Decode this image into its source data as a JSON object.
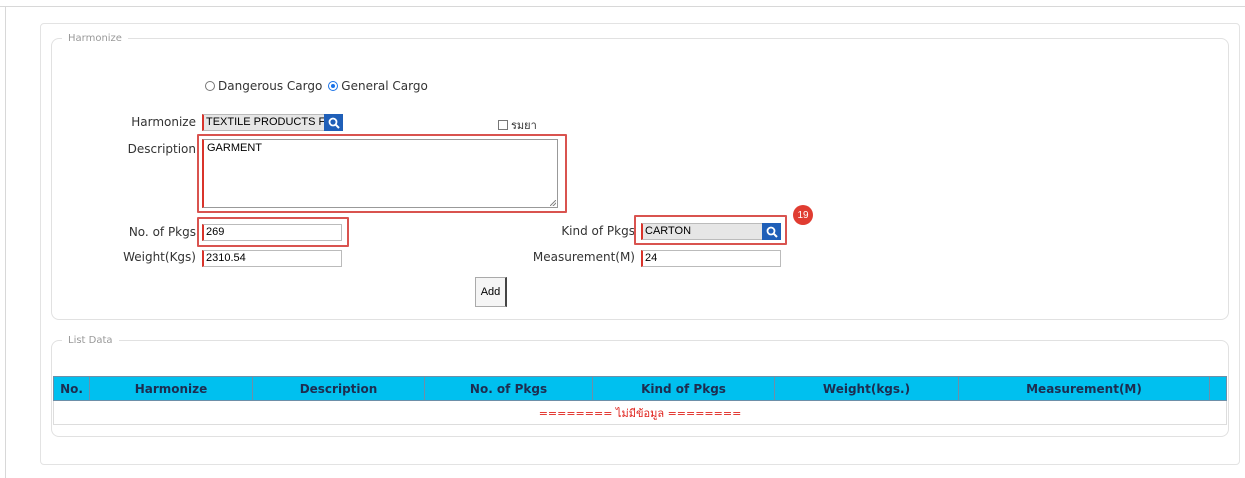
{
  "harmonize_section": {
    "legend": "Harmonize",
    "cargo_type": {
      "options": [
        {
          "label": "Dangerous Cargo",
          "checked": false
        },
        {
          "label": "General Cargo",
          "checked": true
        }
      ]
    },
    "harmonize_label": "Harmonize",
    "harmonize_value": "TEXTILE PRODUCTS F",
    "checkbox_label": "รมยา",
    "description_label": "Description",
    "description_value": "GARMENT",
    "no_pkgs_label": "No. of Pkgs",
    "no_pkgs_value": "269",
    "kind_pkgs_label": "Kind of Pkgs",
    "kind_pkgs_value": "CARTON",
    "weight_label": "Weight(Kgs)",
    "weight_value": "2310.54",
    "measurement_label": "Measurement(M)",
    "measurement_value": "24",
    "add_label": "Add",
    "step_badge": "19"
  },
  "list_section": {
    "legend": "List Data",
    "columns": [
      "No.",
      "Harmonize",
      "Description",
      "No. of Pkgs",
      "Kind of Pkgs",
      "Weight(kgs.)",
      "Measurement(M)",
      ""
    ],
    "empty_message": "======== ไม่มีข้อมูล ========"
  },
  "colors": {
    "accent_blue": "#1f5fb8",
    "table_header": "#00c0ef",
    "highlight_red": "#d9534f",
    "required_red": "#d9342b"
  }
}
